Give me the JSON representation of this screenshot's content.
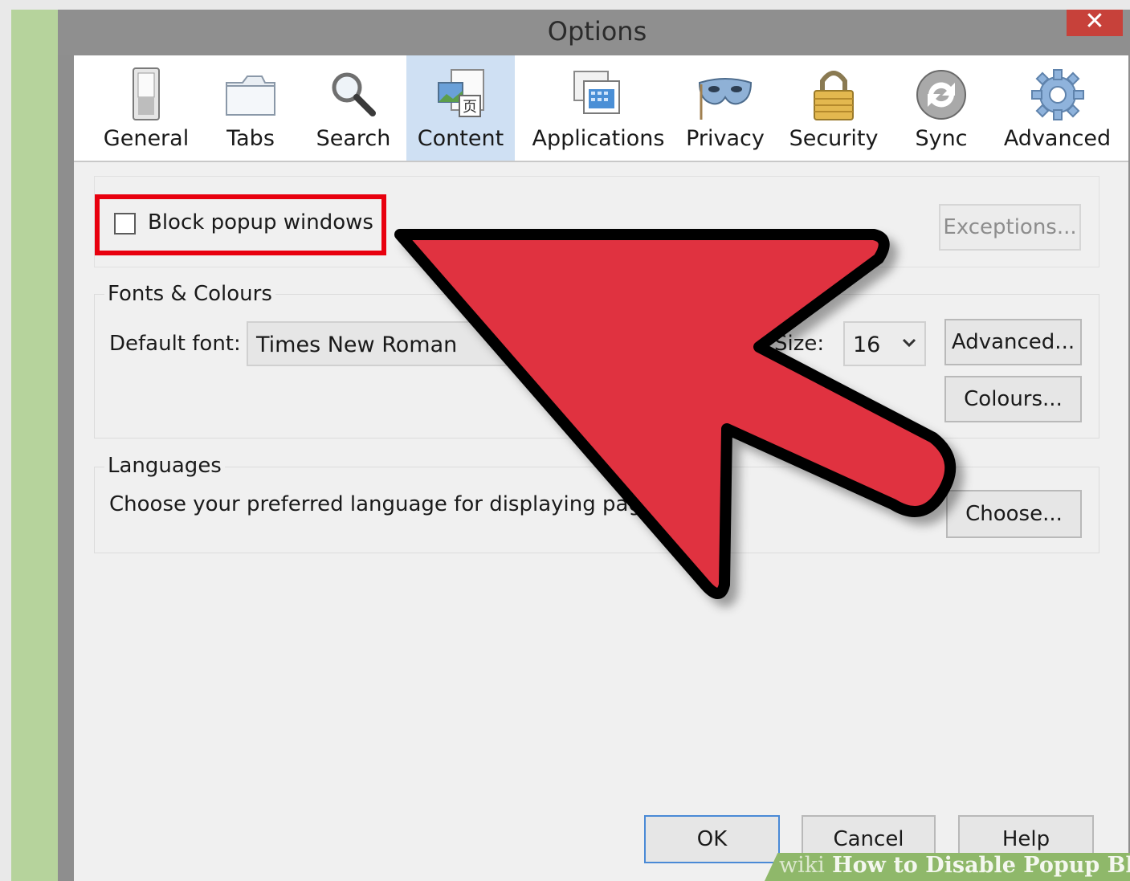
{
  "window": {
    "title": "Options",
    "close_glyph": "✕"
  },
  "toolbar": {
    "items": [
      {
        "label": "General",
        "icon": "switch-icon"
      },
      {
        "label": "Tabs",
        "icon": "folder-tabs-icon"
      },
      {
        "label": "Search",
        "icon": "magnifier-icon"
      },
      {
        "label": "Content",
        "icon": "content-page-icon",
        "selected": true
      },
      {
        "label": "Applications",
        "icon": "applications-icon"
      },
      {
        "label": "Privacy",
        "icon": "mask-icon"
      },
      {
        "label": "Security",
        "icon": "padlock-icon"
      },
      {
        "label": "Sync",
        "icon": "sync-icon"
      },
      {
        "label": "Advanced",
        "icon": "gear-icon"
      }
    ]
  },
  "popup": {
    "checkbox_label": "Block popup windows",
    "checked": false,
    "exceptions_label": "Exceptions..."
  },
  "fonts": {
    "group_title": "Fonts & Colours",
    "default_font_label": "Default font:",
    "default_font_value": "Times New Roman",
    "size_label": "Size:",
    "size_value": "16",
    "advanced_label": "Advanced...",
    "colours_label": "Colours..."
  },
  "languages": {
    "group_title": "Languages",
    "description": "Choose your preferred language for displaying pages",
    "choose_label": "Choose..."
  },
  "footer": {
    "ok_label": "OK",
    "cancel_label": "Cancel",
    "help_label": "Help"
  },
  "watermark": {
    "brand": "wiki",
    "text": "How to Disable Popup Bloc"
  },
  "colors": {
    "highlight": "#e8000e",
    "arrow": "#e0303f",
    "selected_tab": "#cfe0f3",
    "watermark": "#8fb86a"
  }
}
